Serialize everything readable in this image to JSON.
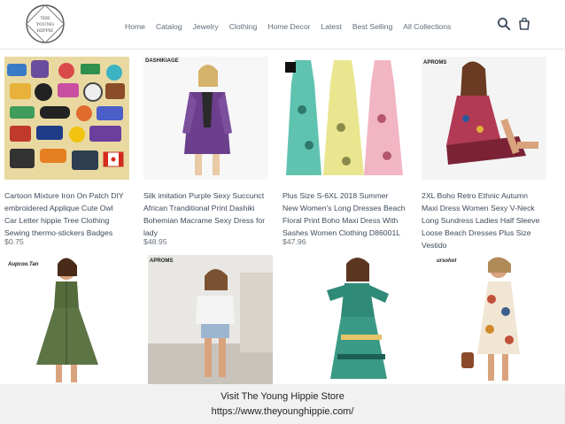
{
  "header": {
    "logo_text_line1": "THE",
    "logo_text_line2": "YOUNG",
    "logo_text_line3": "HIPPIE",
    "nav": [
      "Home",
      "Catalog",
      "Jewelry",
      "Clothing",
      "Home Decor",
      "Latest",
      "Best Selling",
      "All Collections"
    ],
    "search_icon": "search-icon",
    "cart_icon": "cart-icon"
  },
  "products": [
    {
      "title_lines": [
        "Cartoon Mixture Iron On Patch DIY",
        "embroidered Applique Cute Owl",
        "Car Letter hippie Tree Clothing",
        "Sewing thermo-stickers Badges"
      ],
      "price": "$0.75"
    },
    {
      "brand": "DASHIKIAGE",
      "title_lines": [
        "Silk imitation Purple Sexy Succunct",
        "African Tranditional Print Dashiki",
        "Bohemian Macrame Sexy Dress for",
        "lady"
      ],
      "price": "$48.95"
    },
    {
      "title_lines": [
        "Plus Size S-6XL 2018 Summer",
        "New Women's Long Dresses Beach",
        "Floral Print Boho Maxi Dress With",
        "Sashes Women Clothing D86001L"
      ],
      "price": "$47.96"
    },
    {
      "brand": "APROMS",
      "title_lines": [
        "2XL Boho Retro Ethnic Autumn",
        "Maxi Dress Women Sexy V-Neck",
        "Long Sundress Ladies Half Sleeve",
        "Loose Beach Dresses Plus Size",
        "Vestido"
      ],
      "price": ""
    },
    {
      "brand": "Aupcoo.Tan"
    },
    {
      "brand": "APROMS"
    },
    {},
    {
      "brand": "ursohot"
    }
  ],
  "banner": {
    "line1": "Visit The Young Hippie Store",
    "line2": "https://www.theyounghippie.com/"
  },
  "colors": {
    "nav_text": "#5f6b7a",
    "banner_bg": "#f1f1f1"
  }
}
